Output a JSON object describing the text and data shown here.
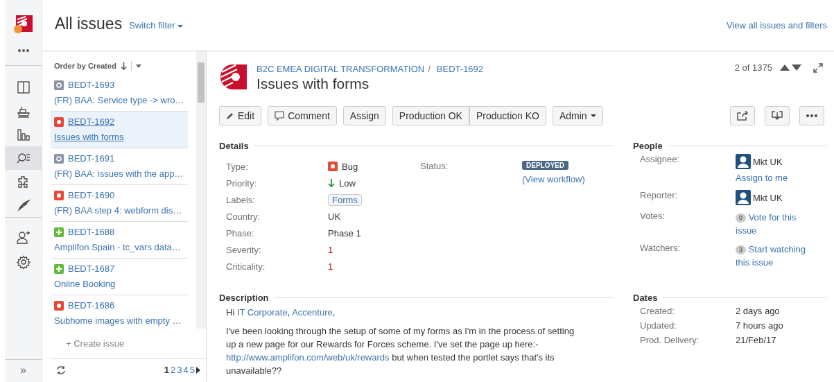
{
  "sidebar": {
    "items": [
      {
        "selected": false
      },
      {
        "selected": false
      },
      {
        "selected": false
      },
      {
        "selected": true
      },
      {
        "selected": false
      },
      {
        "selected": false
      }
    ],
    "expand_label": "»"
  },
  "header": {
    "title": "All issues",
    "switch_filter": "Switch filter",
    "view_all": "View all issues and filters"
  },
  "issue_list": {
    "order_label": "Order by Created",
    "items": [
      {
        "key": "BEDT-1693",
        "summary": "(FR) BAA: Service type -> wro…",
        "kind": "task",
        "selected": false
      },
      {
        "key": "BEDT-1692",
        "summary": "Issues with forms",
        "kind": "bug",
        "selected": true
      },
      {
        "key": "BEDT-1691",
        "summary": "(FR) BAA: issues with the app…",
        "kind": "task",
        "selected": false
      },
      {
        "key": "BEDT-1690",
        "summary": "(FR) BAA step 4: webform dis…",
        "kind": "bug",
        "selected": false
      },
      {
        "key": "BEDT-1688",
        "summary": "Amplifon Spain - tc_vars data…",
        "kind": "feature",
        "selected": false
      },
      {
        "key": "BEDT-1687",
        "summary": "Online Booking",
        "kind": "feature",
        "selected": false
      },
      {
        "key": "BEDT-1686",
        "summary": "Subhome images with empty …",
        "kind": "bug",
        "selected": false
      }
    ],
    "create_label": "+ Create issue",
    "pages": [
      {
        "label": "1",
        "selected": true
      },
      {
        "label": "2",
        "selected": false
      },
      {
        "label": "3",
        "selected": false
      },
      {
        "label": "4",
        "selected": false
      },
      {
        "label": "5",
        "selected": false
      }
    ]
  },
  "issue": {
    "project": "B2C EMEA DIGITAL TRANSFORMATION",
    "separator": "/",
    "key": "BEDT-1692",
    "title": "Issues with forms",
    "position": "2 of 1375",
    "buttons": [
      {
        "label": "Edit",
        "kind": "edit"
      },
      {
        "label": "Comment",
        "kind": "comment"
      },
      {
        "label": "Assign",
        "kind": "plain"
      },
      {
        "label": "Production OK",
        "kind": "group-start"
      },
      {
        "label": "Production KO",
        "kind": "group-end"
      },
      {
        "label": "Admin",
        "kind": "dropdown"
      }
    ],
    "details_heading": "Details",
    "fields": [
      {
        "label": "Type:",
        "value": "Bug",
        "kind": "issue-type"
      },
      {
        "label": "Priority:",
        "value": "Low",
        "kind": "priority"
      },
      {
        "label": "Labels:",
        "value": "Forms",
        "kind": "label"
      },
      {
        "label": "Country:",
        "value": "UK",
        "kind": "plain"
      },
      {
        "label": "Phase:",
        "value": "Phase 1",
        "kind": "plain"
      },
      {
        "label": "Severity:",
        "value": "1",
        "kind": "number"
      },
      {
        "label": "Criticality:",
        "value": "1",
        "kind": "number"
      }
    ],
    "status_label": "Status:",
    "status": "DEPLOYED",
    "view_workflow_open": "(",
    "view_workflow": "View workflow",
    "view_workflow_close": ")",
    "description_heading": "Description",
    "description": [
      [
        {
          "kind": "text",
          "text": "Hi "
        },
        {
          "kind": "link",
          "text": "IT Corporate"
        },
        {
          "kind": "text",
          "text": ", "
        },
        {
          "kind": "link",
          "text": "Accenture"
        },
        {
          "kind": "text",
          "text": ","
        }
      ],
      [
        {
          "kind": "text",
          "text": "I've been looking through the setup of some of my forms as I'm in the process of setting up a new page for our Rewards for Forces scheme. I've set the page up here:- "
        },
        {
          "kind": "link",
          "text": "http://www.amplifon.com/web/uk/rewards"
        },
        {
          "kind": "text",
          "text": " but when tested the portlet says that's its unavailable??"
        }
      ]
    ],
    "people_heading": "People",
    "people": [
      {
        "label": "Assignee:",
        "kind": "user",
        "value": "Mkt UK",
        "link": "Assign to me"
      },
      {
        "label": "Reporter:",
        "kind": "user",
        "value": "Mkt UK"
      },
      {
        "label": "Votes:",
        "kind": "count",
        "count": "0",
        "link": "Vote for this issue"
      },
      {
        "label": "Watchers:",
        "kind": "count",
        "count": "3",
        "link": "Start watching this issue"
      }
    ],
    "dates_heading": "Dates",
    "dates": [
      {
        "label": "Created:",
        "value": "2 days ago"
      },
      {
        "label": "Updated:",
        "value": "7 hours ago"
      },
      {
        "label": "Prod. Delivery:",
        "value": "21/Feb/17"
      }
    ]
  }
}
